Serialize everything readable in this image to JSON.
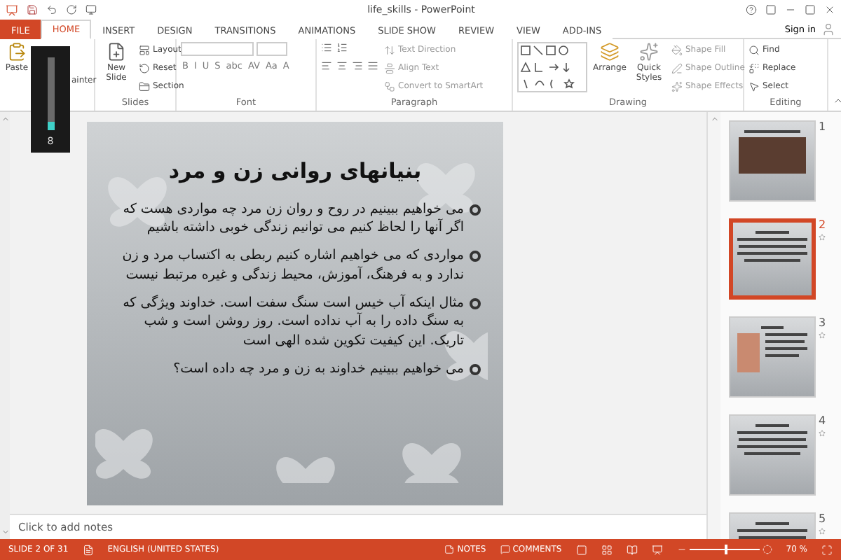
{
  "window": {
    "title": "life_skills - PowerPoint",
    "sign_in": "Sign in"
  },
  "tabs": [
    {
      "label": "FILE",
      "kind": "file",
      "selected": false
    },
    {
      "label": "HOME",
      "kind": "tab",
      "selected": true
    },
    {
      "label": "INSERT",
      "kind": "tab",
      "selected": false
    },
    {
      "label": "DESIGN",
      "kind": "tab",
      "selected": false
    },
    {
      "label": "TRANSITIONS",
      "kind": "tab",
      "selected": false
    },
    {
      "label": "ANIMATIONS",
      "kind": "tab",
      "selected": false
    },
    {
      "label": "SLIDE SHOW",
      "kind": "tab",
      "selected": false
    },
    {
      "label": "REVIEW",
      "kind": "tab",
      "selected": false
    },
    {
      "label": "VIEW",
      "kind": "tab",
      "selected": false
    },
    {
      "label": "ADD-INS",
      "kind": "tab",
      "selected": false
    }
  ],
  "ribbon": {
    "clipboard": {
      "paste": "Paste",
      "painter": "ainter"
    },
    "slides": {
      "new_slide": "New Slide",
      "items": [
        "Layout",
        "Reset",
        "Section"
      ],
      "label": "Slides"
    },
    "font": {
      "format_buttons": [
        "B",
        "I",
        "U",
        "S",
        "abc",
        "AV",
        "Aa",
        "A"
      ],
      "label": "Font"
    },
    "paragraph": {
      "items": [
        "Text Direction",
        "Align Text",
        "Convert to SmartArt"
      ],
      "label": "Paragraph"
    },
    "drawing": {
      "arrange": "Arrange",
      "quick_styles": "Quick Styles",
      "items": [
        "Shape Fill",
        "Shape Outline",
        "Shape Effects"
      ],
      "label": "Drawing"
    },
    "editing": {
      "items": [
        "Find",
        "Replace",
        "Select"
      ],
      "label": "Editing"
    }
  },
  "volume_overlay": {
    "level": 0.12,
    "value": "8"
  },
  "slide": {
    "title": "بنیانهای روانی زن و مرد",
    "bullets": [
      "می خواهیم ببینیم در روح و روان زن مرد چه مواردی هست که اگر آنها را لحاظ کنیم می توانیم زندگی خوبی داشته باشیم",
      "مواردی که می خواهیم اشاره کنیم ربطی به اکتساب مرد و زن ندارد و به فرهنگ، آموزش، محیط زندگی و غیره مرتبط نیست",
      "مثال اینکه آب خیس است سنگ سفت است. خداوند ویژگی که به سنگ داده را به آب نداده است. روز روشن است و شب تاریک. این کیفیت تکوین شده الهی است",
      "می خواهیم ببینیم خداوند به زن و مرد چه داده است؟"
    ]
  },
  "thumbnails": [
    {
      "number": "1",
      "selected": false,
      "kind": "photo"
    },
    {
      "number": "2",
      "selected": true,
      "kind": "text"
    },
    {
      "number": "3",
      "selected": false,
      "kind": "figure"
    },
    {
      "number": "4",
      "selected": false,
      "kind": "text"
    },
    {
      "number": "5",
      "selected": false,
      "kind": "text"
    }
  ],
  "notes": {
    "placeholder": "Click to add notes"
  },
  "status_bar": {
    "slide": "SLIDE 2 OF 31",
    "language": "ENGLISH (UNITED STATES)",
    "notes": "NOTES",
    "comments": "COMMENTS",
    "zoom": "70 %",
    "zoom_slider": {
      "level": 0.5
    }
  }
}
